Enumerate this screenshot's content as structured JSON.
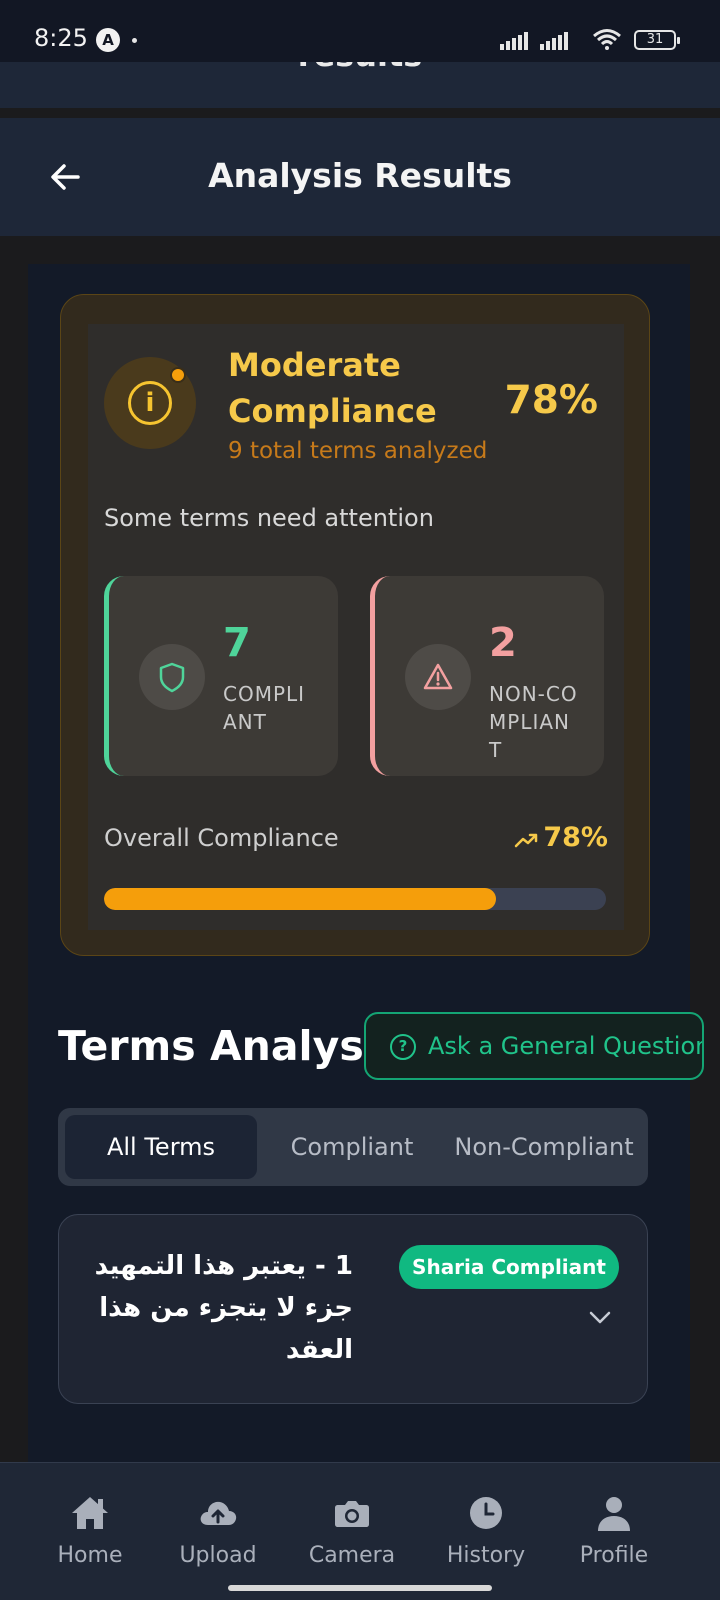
{
  "status_bar": {
    "time": "8:25",
    "app_icon": "A",
    "battery": "31"
  },
  "ghost_header": {
    "title": "results"
  },
  "header": {
    "title": "Analysis Results",
    "back_icon": "arrow-left-icon"
  },
  "summary": {
    "level_title": "Moderate Compliance",
    "percentage": "78%",
    "terms_count_label": "9 total terms analyzed",
    "message": "Some terms need attention",
    "compliant": {
      "count": "7",
      "label": "COMPLIANT"
    },
    "non_compliant": {
      "count": "2",
      "label": "NON-COMPLIANT"
    },
    "overall_label": "Overall Compliance",
    "overall_percentage": "78%",
    "progress": 0.78
  },
  "terms_section": {
    "heading": "Terms Analysis",
    "ask_button_label": "Ask a General Question",
    "tabs": [
      {
        "label": "All Terms",
        "active": true
      },
      {
        "label": "Compliant",
        "active": false
      },
      {
        "label": "Non-Compliant",
        "active": false
      }
    ],
    "items": [
      {
        "text": "1 - يعتبر هذا التمهيد جزء لا يتجزء من هذا العقد",
        "badge": "Sharia Compliant"
      }
    ]
  },
  "bottom_nav": [
    {
      "label": "Home",
      "icon": "home-icon"
    },
    {
      "label": "Upload",
      "icon": "cloud-upload-icon"
    },
    {
      "label": "Camera",
      "icon": "camera-icon"
    },
    {
      "label": "History",
      "icon": "clock-icon"
    },
    {
      "label": "Profile",
      "icon": "person-icon"
    }
  ],
  "colors": {
    "accent_amber": "#f59e0b",
    "title_yellow": "#f6c94a",
    "compliant_green": "#4fd49a",
    "non_compliant_red": "#f3a0a0",
    "badge_green": "#10b981"
  }
}
